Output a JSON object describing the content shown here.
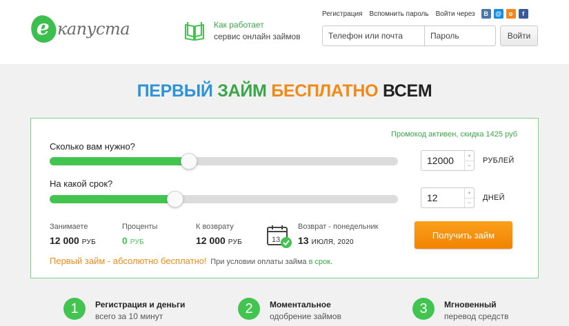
{
  "header": {
    "logo": {
      "letter": "е",
      "text": "капуста"
    },
    "how": {
      "line1": "Как работает",
      "line2": "сервис онлайн займов",
      "icon": "book-icon"
    },
    "links": {
      "register": "Регистрация",
      "remember": "Вспомнить пароль",
      "enter_via": "Войти через"
    },
    "social": [
      {
        "name": "vk-icon",
        "glyph": "В",
        "color": "#4a76a8"
      },
      {
        "name": "mail-icon",
        "glyph": "@",
        "color": "#168de2"
      },
      {
        "name": "ok-icon",
        "glyph": "о",
        "color": "#f2871f"
      },
      {
        "name": "facebook-icon",
        "glyph": "f",
        "color": "#3b5998"
      }
    ],
    "login": {
      "phone_placeholder": "Телефон или почта",
      "password_placeholder": "Пароль",
      "button": "Войти"
    }
  },
  "headline": {
    "p1": "ПЕРВЫЙ",
    "p2": "ЗАЙМ",
    "p3": "БЕСПЛАТНО",
    "p4": "ВСЕМ"
  },
  "calculator": {
    "promo": "Промокод активен, скидка 1425 руб",
    "amount": {
      "label": "Сколько вам нужно?",
      "value": "12000",
      "unit": "РУБЛЕЙ",
      "fraction": 0.4
    },
    "term": {
      "label": "На какой срок?",
      "value": "12",
      "unit": "ДНЕЙ",
      "fraction": 0.36
    },
    "spin_up": "+",
    "spin_down": "−",
    "borrow": {
      "title": "Занимаете",
      "value": "12 000",
      "cur": "РУБ"
    },
    "percent": {
      "title": "Проценты",
      "value": "0",
      "cur": "РУБ"
    },
    "to_return": {
      "title": "К возврату",
      "value": "12 000",
      "cur": "РУБ"
    },
    "return_date": {
      "title": "Возврат - понедельник",
      "day": "13",
      "month_year": "ИЮЛЯ, 2020",
      "cal_day": "13"
    },
    "get_button": "Получить займ",
    "free": {
      "main": "Первый займ - абсолютно бесплатно!",
      "cond_pre": "При условии оплаты займа",
      "cond_link": "в срок",
      "cond_post": "."
    }
  },
  "steps": [
    {
      "num": "1",
      "line1": "Регистрация и деньги",
      "line2": "всего за 10 минут"
    },
    {
      "num": "2",
      "line1": "Моментальное",
      "line2": "одобрение займов"
    },
    {
      "num": "3",
      "line1": "Мгновенный",
      "line2": "перевод средств"
    }
  ],
  "colors": {
    "green": "#43c451",
    "orange": "#f08a16",
    "blue": "#2e93d6"
  }
}
